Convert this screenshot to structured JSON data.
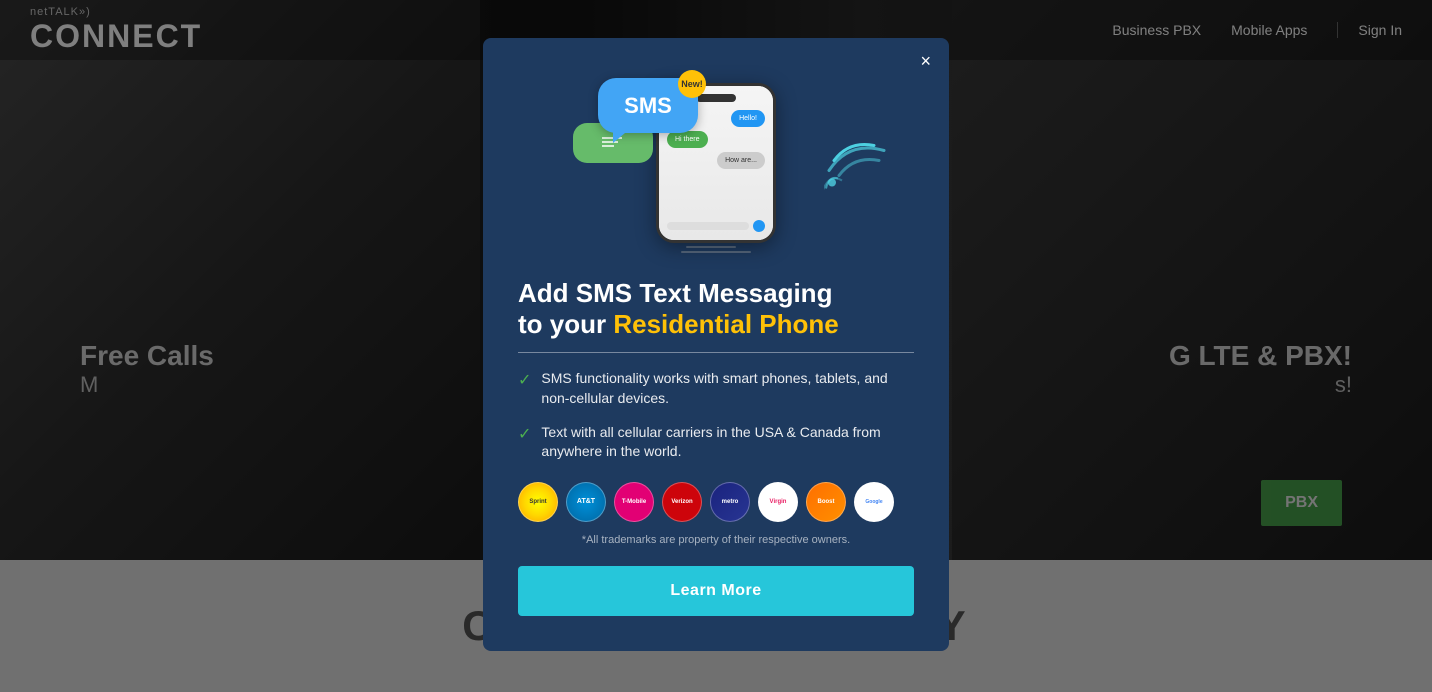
{
  "brand": {
    "nettalk_label": "netTALK»)",
    "connect_label": "CONNECT"
  },
  "header": {
    "nav_items": [
      {
        "label": "Business PBX",
        "id": "nav-business-pbx"
      },
      {
        "label": "Mobile Apps",
        "id": "nav-mobile-apps"
      },
      {
        "label": "Sign In",
        "id": "nav-sign-in"
      }
    ]
  },
  "background": {
    "left_heading": "Free Calls",
    "left_sub": "M",
    "right_heading": "G LTE & PBX!",
    "right_sub": "s!",
    "pbx_button": "PBX",
    "bottom_title": "CONNECT YOUR WAY"
  },
  "modal": {
    "close_label": "×",
    "heading_line1": "Add SMS Text Messaging",
    "heading_line2_prefix": "to your ",
    "heading_highlight": "Residential Phone",
    "features": [
      "SMS functionality works with smart phones, tablets, and non-cellular devices.",
      "Text with all cellular carriers in the USA & Canada from anywhere in the world."
    ],
    "carriers": [
      {
        "name": "Sprint",
        "class": "carrier-sprint",
        "label": "Sprint"
      },
      {
        "name": "AT&T",
        "class": "carrier-att",
        "label": "AT&T"
      },
      {
        "name": "T-Mobile",
        "class": "carrier-tmobile",
        "label": "T-Mobile"
      },
      {
        "name": "Verizon",
        "class": "carrier-verizon",
        "label": "Verizon"
      },
      {
        "name": "Metro",
        "class": "carrier-metro",
        "label": "metro"
      },
      {
        "name": "Virgin",
        "class": "carrier-virgin",
        "label": "Virgin"
      },
      {
        "name": "Boost",
        "class": "carrier-boost",
        "label": "Boost"
      },
      {
        "name": "Google Fi",
        "class": "carrier-google",
        "label": "Google Fi"
      }
    ],
    "trademark_note": "*All trademarks are property of their respective owners.",
    "learn_more_label": "Learn More",
    "sms_label": "SMS",
    "new_badge": "New!",
    "feature1": "SMS functionality works with smart phones, tablets, and non-cellular devices.",
    "feature2": "Text with all cellular carriers in the USA & Canada from anywhere in the world."
  }
}
